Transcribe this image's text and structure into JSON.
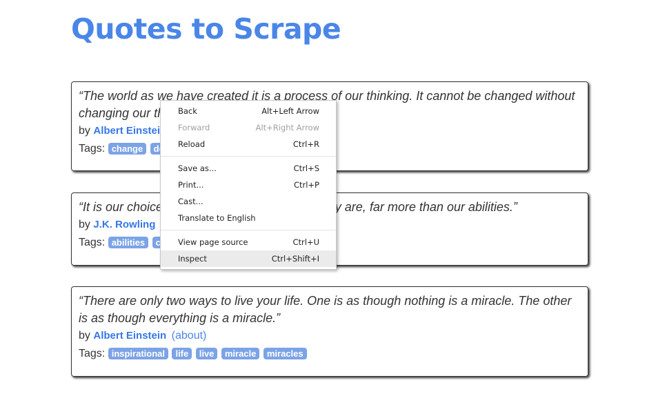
{
  "title": "Quotes to Scrape",
  "by_label": "by",
  "about_label": "(about)",
  "tags_label": "Tags:",
  "quotes": [
    {
      "text": "“The world as we have created it is a process of our thinking. It cannot be changed without changing our thinking.”",
      "author": "Albert Einstein",
      "tags": [
        "change",
        "deep-thoughts"
      ]
    },
    {
      "text": "“It is our choices, Harry, that show what we truly are, far more than our abilities.”",
      "author": "J.K. Rowling",
      "tags": [
        "abilities",
        "choices"
      ]
    },
    {
      "text": "“There are only two ways to live your life. One is as though nothing is a miracle. The other is as though everything is a miracle.”",
      "author": "Albert Einstein",
      "tags": [
        "inspirational",
        "life",
        "live",
        "miracle",
        "miracles"
      ]
    }
  ],
  "context_menu": {
    "items": [
      {
        "label": "Back",
        "shortcut": "Alt+Left Arrow"
      },
      {
        "label": "Forward",
        "shortcut": "Alt+Right Arrow",
        "disabled": true
      },
      {
        "label": "Reload",
        "shortcut": "Ctrl+R"
      },
      {
        "label": "Save as...",
        "shortcut": "Ctrl+S"
      },
      {
        "label": "Print...",
        "shortcut": "Ctrl+P"
      },
      {
        "label": "Cast...",
        "shortcut": ""
      },
      {
        "label": "Translate to English",
        "shortcut": ""
      },
      {
        "label": "View page source",
        "shortcut": "Ctrl+U"
      },
      {
        "label": "Inspect",
        "shortcut": "Ctrl+Shift+I",
        "highlighted": true
      }
    ]
  }
}
